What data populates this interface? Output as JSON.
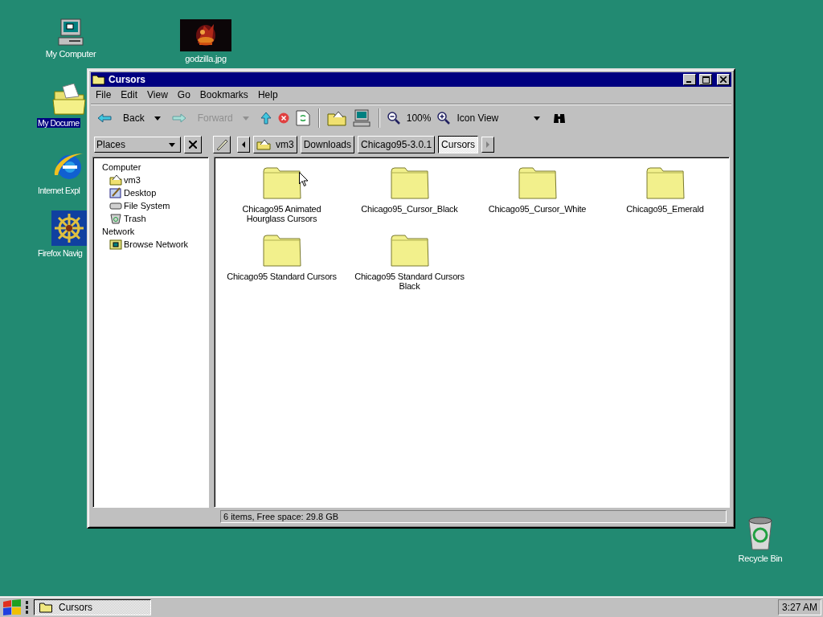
{
  "desktop_icons": [
    {
      "kind": "computer",
      "label": "My Computer",
      "selected": false
    },
    {
      "kind": "picture",
      "label": "godzilla.jpg",
      "selected": false
    },
    {
      "kind": "documents",
      "label": "My Docume",
      "selected": true
    },
    {
      "kind": "browser",
      "label": "Internet Expl",
      "selected": false
    },
    {
      "kind": "wheel",
      "label": "Firefox Navig",
      "selected": false
    },
    {
      "kind": "recycle",
      "label": "Recycle Bin",
      "selected": false
    }
  ],
  "window": {
    "title": "Cursors",
    "menu": [
      "File",
      "Edit",
      "View",
      "Go",
      "Bookmarks",
      "Help"
    ],
    "toolbar": {
      "back": {
        "label": "Back",
        "disabled": false
      },
      "forward": {
        "label": "Forward",
        "disabled": true
      },
      "zoom": "100%",
      "view": "Icon View"
    },
    "places": {
      "label": "Places"
    },
    "tree": [
      {
        "label": "Computer",
        "children": [
          {
            "label": "vm3",
            "kind": "home"
          },
          {
            "label": "Desktop",
            "kind": "desktop"
          },
          {
            "label": "File System",
            "kind": "drive"
          },
          {
            "label": "Trash",
            "kind": "trash"
          }
        ]
      },
      {
        "label": "Network",
        "children": [
          {
            "label": "Browse Network",
            "kind": "network"
          }
        ]
      }
    ],
    "path": [
      {
        "label": "vm3",
        "kind": "home",
        "selected": false
      },
      {
        "label": "Downloads",
        "kind": "plain",
        "selected": false
      },
      {
        "label": "Chicago95-3.0.1",
        "kind": "plain",
        "selected": false
      },
      {
        "label": "Cursors",
        "kind": "plain",
        "selected": true
      }
    ],
    "files": [
      {
        "label": "Chicago95 Animated Hourglass Cursors"
      },
      {
        "label": "Chicago95_Cursor_Black"
      },
      {
        "label": "Chicago95_Cursor_White"
      },
      {
        "label": "Chicago95_Emerald"
      },
      {
        "label": "Chicago95 Standard Cursors"
      },
      {
        "label": "Chicago95 Standard Cursors Black"
      }
    ],
    "status": "6 items, Free space: 29.8 GB"
  },
  "taskbar": {
    "tasks": [
      {
        "label": "Cursors",
        "selected": true
      }
    ],
    "clock": "3:27 AM"
  }
}
